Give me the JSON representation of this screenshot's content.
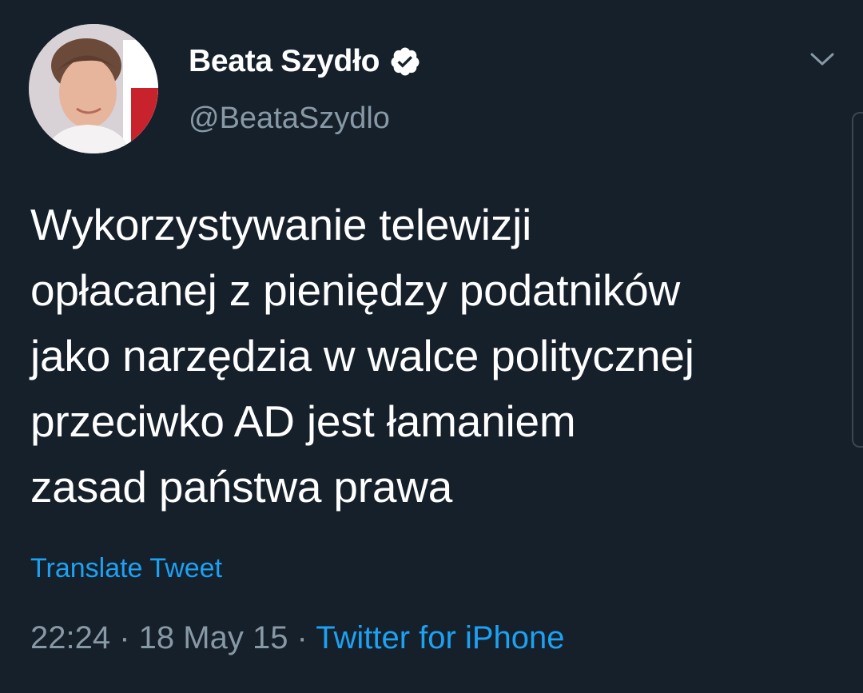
{
  "author": {
    "display_name": "Beata Szydło",
    "handle": "@BeataSzydlo",
    "verified": true,
    "verified_icon": "verified-badge-icon",
    "avatar": "profile-photo"
  },
  "menu_icon": "chevron-down-icon",
  "tweet": {
    "lines": [
      "Wykorzystywanie telewizji",
      "opłacanej z pieniędzy podatników",
      "jako narzędzia w walce politycznej",
      "przeciwko AD jest łamaniem",
      "zasad państwa prawa"
    ]
  },
  "translate_label": "Translate Tweet",
  "meta": {
    "time": "22:24",
    "separator": " · ",
    "date": "18 May 15",
    "source": "Twitter for iPhone"
  },
  "colors": {
    "background": "#15202b",
    "text": "#ffffff",
    "secondary": "#8899a6",
    "accent": "#1da1f2"
  }
}
